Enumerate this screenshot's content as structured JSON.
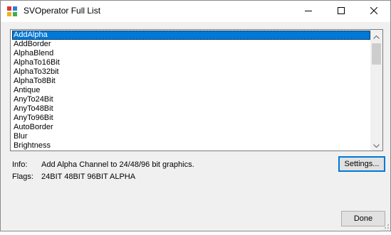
{
  "window": {
    "title": "SVOperator Full List"
  },
  "list": {
    "items": [
      "AddAlpha",
      "AddBorder",
      "AlphaBlend",
      "AlphaTo16Bit",
      "AlphaTo32bit",
      "AlphaTo8Bit",
      "Antique",
      "AnyTo24Bit",
      "AnyTo48Bit",
      "AnyTo96Bit",
      "AutoBorder",
      "Blur",
      "Brightness"
    ],
    "selected_index": 0
  },
  "details": {
    "info_label": "Info:",
    "info_text": "Add Alpha Channel to 24/48/96 bit graphics.",
    "flags_label": "Flags:",
    "flags_text": "24BIT 48BIT 96BIT ALPHA"
  },
  "buttons": {
    "settings_label": "Settings...",
    "done_label": "Done"
  },
  "icons": {
    "app": "app-icon",
    "minimize": "minimize-icon",
    "maximize": "maximize-icon",
    "close": "close-icon"
  },
  "colors": {
    "selection": "#0078d7",
    "window_bg": "#f0f0f0"
  }
}
